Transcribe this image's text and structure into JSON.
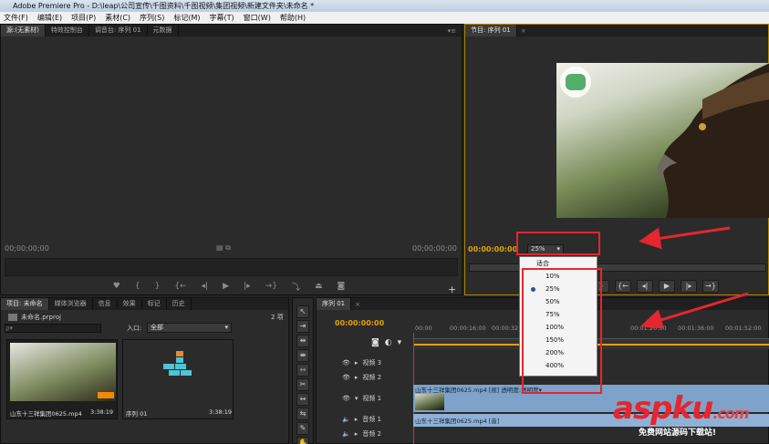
{
  "window": {
    "title": "Adobe Premiere Pro - D:\\leap\\公司宣传\\千图资料\\千图视频\\集团视频\\新建文件夹\\未命名 *"
  },
  "menu": [
    "文件(F)",
    "编辑(E)",
    "项目(P)",
    "素材(C)",
    "序列(S)",
    "标记(M)",
    "字幕(T)",
    "窗口(W)",
    "帮助(H)"
  ],
  "source_panel": {
    "tabs": [
      "源:(无素材)",
      "特效控制台",
      "调音台: 序列 01",
      "元数据"
    ],
    "timecode_left": "00;00;00;00",
    "timecode_right": "00;00;00;00"
  },
  "program_panel": {
    "tab": "节目: 序列 01",
    "timecode": "00:00:00:00",
    "zoom_value": "25%",
    "zoom_menu": {
      "items": [
        "适合",
        "10%",
        "25%",
        "50%",
        "75%",
        "100%",
        "150%",
        "200%",
        "400%"
      ],
      "selected": "25%"
    }
  },
  "project_panel": {
    "tabs": [
      "项目: 未命名",
      "媒体浏览器",
      "信息",
      "效果",
      "标记",
      "历史"
    ],
    "project_file": "未命名.prproj",
    "item_count": "2 项",
    "search_placeholder": "ρ▾",
    "in_label": "入口:",
    "in_value": "全部",
    "items": [
      {
        "name": "山东十三祥集团0625.mp4",
        "duration": "3:38:19"
      },
      {
        "name": "序列 01",
        "duration": "3:38:19"
      }
    ]
  },
  "timeline": {
    "tab": "序列 01",
    "timecode": "00:00:00:00",
    "ruler": [
      "00:00",
      "00:00:16:00",
      "00:00:32:00",
      "00:01:20:00",
      "00:01:36:00",
      "00:01:52:00"
    ],
    "tracks": [
      {
        "name": "视频 3"
      },
      {
        "name": "视频 2"
      },
      {
        "name": "视频 1"
      },
      {
        "name": "音频 1"
      },
      {
        "name": "音频 2"
      }
    ],
    "video_clip": "山东十三祥集团0625.mp4 [视] 透明度:透明度▾",
    "audio_clip": "山东十三祥集团0625.mp4 [音]"
  },
  "watermark": {
    "brand": "aspku",
    "domain": ".com",
    "tagline": "免费网站源码下载站!"
  },
  "colors": {
    "accent": "#e3a300",
    "annotation": "#e5262e",
    "clip": "#7ea2c9"
  }
}
